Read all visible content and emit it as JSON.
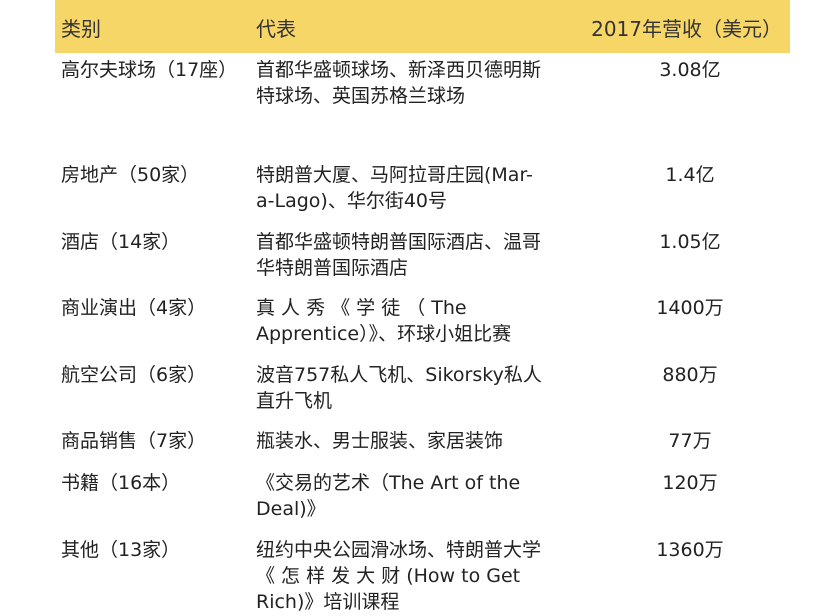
{
  "header": {
    "category": "类别",
    "representative": "代表",
    "revenue": "2017年营收（美元）"
  },
  "rows": [
    {
      "category": "高尔夫球场（17座）",
      "rep_lines": [
        "首都华盛顿球场、新泽西贝德明斯",
        "特球场、英国苏格兰球场"
      ],
      "revenue": "3.08亿"
    },
    {
      "category": "房地产（50家）",
      "rep_lines": [
        "特朗普大厦、马阿拉哥庄园(Mar-",
        "a-Lago)、华尔街40号"
      ],
      "revenue": "1.4亿"
    },
    {
      "category": "酒店（14家）",
      "rep_lines": [
        "首都华盛顿特朗普国际酒店、温哥",
        "华特朗普国际酒店"
      ],
      "revenue": "1.05亿"
    },
    {
      "category": "商业演出（4家）",
      "rep_lines": [
        "真 人 秀 《 学 徒 （ The",
        "Apprentice）》、环球小姐比赛"
      ],
      "revenue": "1400万"
    },
    {
      "category": "航空公司（6家）",
      "rep_lines": [
        "波音757私人飞机、Sikorsky私人",
        "直升飞机"
      ],
      "revenue": "880万"
    },
    {
      "category": "商品销售（7家）",
      "rep_lines": [
        "瓶装水、男士服装、家居装饰"
      ],
      "revenue": "77万"
    },
    {
      "category": "书籍（16本）",
      "rep_lines": [
        "《交易的艺术（The Art of the",
        "Deal)》"
      ],
      "revenue": "120万"
    },
    {
      "category": "其他（13家）",
      "rep_lines": [
        "纽约中央公园滑冰场、特朗普大学",
        "《 怎 样 发 大 财 (How to Get",
        "Rich)》培训课程"
      ],
      "revenue": "1360万"
    }
  ]
}
